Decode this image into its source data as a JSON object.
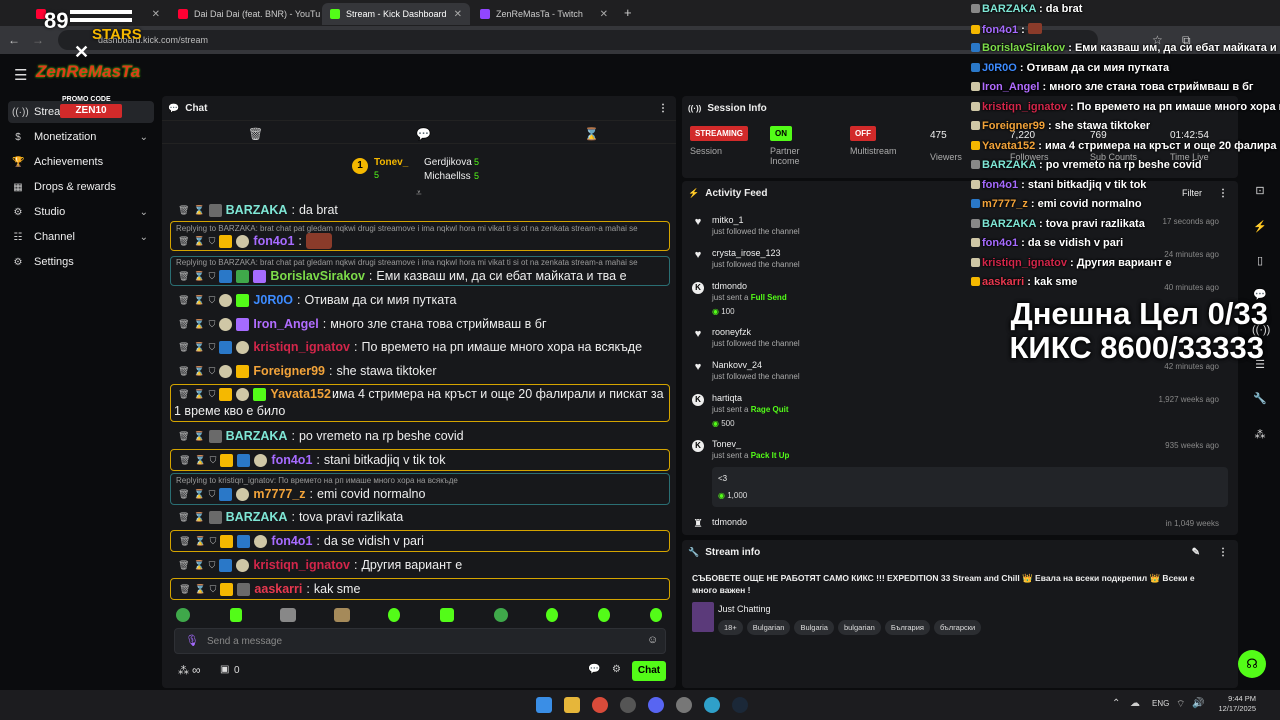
{
  "browser": {
    "tabs": [
      {
        "label": "",
        "color": "#ff0033"
      },
      {
        "label": "Dai Dai Dai (feat. BNR) - YouTub",
        "color": "#ff0033"
      },
      {
        "label": "Stream - Kick Dashboard",
        "color": "#53fc18"
      },
      {
        "label": "ZenReMasTa - Twitch",
        "color": "#9146ff"
      }
    ],
    "url": "dashboard.kick.com/stream"
  },
  "sidebar": {
    "items": [
      {
        "label": "Stream",
        "icon": "broadcast-icon",
        "active": true
      },
      {
        "label": "Monetization",
        "icon": "dollar-icon"
      },
      {
        "label": "Achievements",
        "icon": "trophy-icon"
      },
      {
        "label": "Drops & rewards",
        "icon": "drops-icon"
      },
      {
        "label": "Studio",
        "icon": "gear-icon"
      },
      {
        "label": "Channel",
        "icon": "people-icon"
      },
      {
        "label": "Settings",
        "icon": "settings-icon"
      }
    ]
  },
  "logo": {
    "top": "89",
    "stars": "STARS",
    "name": "ZenReMasTa",
    "promo": "PROMO CODE",
    "code": "ZEN10"
  },
  "chat": {
    "title": "Chat",
    "leaders": [
      {
        "name": "Tonev_",
        "count": "5"
      },
      {
        "name": "Gerdjikova",
        "count": "5"
      },
      {
        "name": "Michaellss",
        "count": "5"
      }
    ],
    "messages": [
      {
        "user": "BARZAKA",
        "color": "#7fe7d6",
        "text": "da brat"
      },
      {
        "reply": "Replying to BARZAKA: brat chat pat gledam nqkwi drugi streamove i ima nqkwl hora mi vikat ti si ot na zenkata stream-a mahai se",
        "user": "fon4o1",
        "color": "#a66bff",
        "text": ""
      },
      {
        "reply": "Replying to BARZAKA: brat chat pat gledam nqkwi drugi streamove i ima nqkwl hora mi vikat ti si ot na zenkata stream-a mahai se",
        "user": "BorislavSirakov",
        "color": "#7ddc4a",
        "text": "Еми казваш им, да си ебат майката и тва е"
      },
      {
        "user": "J0R0O",
        "color": "#3d8bff",
        "text": "Отивам да си мия путката"
      },
      {
        "user": "Iron_Angel",
        "color": "#b16cff",
        "text": "много зле стана това стриймваш в бг"
      },
      {
        "user": "kristiqn_ignatov",
        "color": "#d2264a",
        "text": "По времето на рп имаше много хора на всякъде"
      },
      {
        "user": "Foreigner99",
        "color": "#f2a33a",
        "text": "she stawa tiktoker"
      },
      {
        "user": "Yavata152",
        "color": "#f2a33a",
        "text": "има 4 стримера на кръст и още 20 фалирали и пискат за 1 време кво е било"
      },
      {
        "user": "BARZAKA",
        "color": "#7fe7d6",
        "text": "po vremeto na rp beshe covid"
      },
      {
        "user": "fon4o1",
        "color": "#a66bff",
        "text": "stani bitkadjiq v tik tok"
      },
      {
        "reply": "Replying to kristiqn_ignatov: По времето на рп имаше много хора на всякъде",
        "user": "m7777_z",
        "color": "#f2a33a",
        "text": "emi covid normalno"
      },
      {
        "user": "BARZAKA",
        "color": "#7fe7d6",
        "text": "tova pravi razlikata"
      },
      {
        "user": "fon4o1",
        "color": "#a66bff",
        "text": "da se vidish v pari"
      },
      {
        "user": "kristiqn_ignatov",
        "color": "#d2264a",
        "text": "Другия вариант е"
      },
      {
        "user": "aaskarri",
        "color": "#e8384f",
        "text": "kak sme"
      }
    ],
    "input_placeholder": "Send a message",
    "footer_infinity": "∞",
    "footer_count": "0",
    "send_label": "Chat"
  },
  "session": {
    "title": "Session Info",
    "streaming": "STREAMING",
    "session_label": "Session",
    "partner_pill": "ON",
    "partner_label": "Partner Income",
    "multi_pill": "OFF",
    "multi_label": "Multistream",
    "viewers": "475",
    "viewers_label": "Viewers",
    "followers": "7,220",
    "followers_label": "Followers",
    "subs": "769",
    "subs_label": "Sub Counts",
    "time": "01:42:54",
    "time_label": "Time Live"
  },
  "activity": {
    "title": "Activity Feed",
    "filter": "Filter",
    "items": [
      {
        "name": "mitko_1",
        "sub": "just followed the channel",
        "time": "17 seconds ago",
        "icon": "heart"
      },
      {
        "name": "crysta_irose_123",
        "sub": "just followed the channel",
        "time": "24 minutes ago",
        "icon": "heart"
      },
      {
        "name": "tdmondo",
        "sub": "just sent a",
        "item": "Full Send",
        "amount": "100",
        "time": "40 minutes ago",
        "icon": "kick"
      },
      {
        "name": "rooneyfzk",
        "sub": "just followed the channel",
        "time": "",
        "icon": "heart"
      },
      {
        "name": "Nankovv_24",
        "sub": "just followed the channel",
        "time": "42 minutes ago",
        "icon": "heart"
      },
      {
        "name": "hartiqta",
        "sub": "just sent a",
        "item": "Rage Quit",
        "amount": "500",
        "time": "1,927 weeks ago",
        "icon": "kick"
      },
      {
        "name": "Tonev_",
        "sub": "just sent a",
        "item": "Pack It Up",
        "time": "935 weeks ago",
        "icon": "kick"
      },
      {
        "name": "tdmondo",
        "sub": "",
        "time": "in 1,049 weeks",
        "icon": "kick"
      }
    ],
    "note_text": "<3",
    "note_amount": "1,000"
  },
  "streaminfo": {
    "title": "Stream info",
    "stream_title": "СЪБОВЕТЕ ОЩЕ НЕ РАБОТЯТ САМО КИКС !!! EXPEDITION 33 Stream and Chill 👑 Евала на всеки подкрепил 👑 Всеки е много важен !",
    "category": "Just Chatting",
    "tags": [
      "18+",
      "Bulgarian",
      "Bulgaria",
      "bulgarian",
      "България",
      "български"
    ]
  },
  "overlay": {
    "lines": [
      {
        "user": "BARZAKA",
        "color": "#7fe7d6",
        "text": "da brat"
      },
      {
        "user": "fon4o1",
        "color": "#a66bff",
        "text": ""
      },
      {
        "user": "BorislavSirakov",
        "color": "#7ddc4a",
        "text": "Еми казваш им, да си ебат майката и"
      },
      {
        "user": "J0R0O",
        "color": "#3d8bff",
        "text": "Отивам да си мия путката"
      },
      {
        "user": "Iron_Angel",
        "color": "#b16cff",
        "text": "много зле стана това стриймваш в бг"
      },
      {
        "user": "kristiqn_ignatov",
        "color": "#d2264a",
        "text": "По времето на рп имаше много хора на"
      },
      {
        "user": "Foreigner99",
        "color": "#f2a33a",
        "text": "she stawa tiktoker"
      },
      {
        "user": "Yavata152",
        "color": "#f2a33a",
        "text": "има 4 стримера на кръст и още 20 фалира"
      },
      {
        "user": "BARZAKA",
        "color": "#7fe7d6",
        "text": "po vremeto na rp beshe covid"
      },
      {
        "user": "fon4o1",
        "color": "#a66bff",
        "text": "stani bitkadjiq v tik tok"
      },
      {
        "user": "m7777_z",
        "color": "#f2a33a",
        "text": "emi covid normalno"
      },
      {
        "user": "BARZAKA",
        "color": "#7fe7d6",
        "text": "tova pravi razlikata"
      },
      {
        "user": "fon4o1",
        "color": "#a66bff",
        "text": "da se vidish v pari"
      },
      {
        "user": "kristiqn_ignatov",
        "color": "#d2264a",
        "text": "Другия вариант е"
      },
      {
        "user": "aaskarri",
        "color": "#e8384f",
        "text": "kak sme"
      }
    ],
    "goal_line1": "Днешна Цел 0/33",
    "goal_line2": "КИКС 8600/33333"
  },
  "taskbar": {
    "lang": "ENG",
    "time": "9:44 PM",
    "date": "12/17/2025"
  }
}
